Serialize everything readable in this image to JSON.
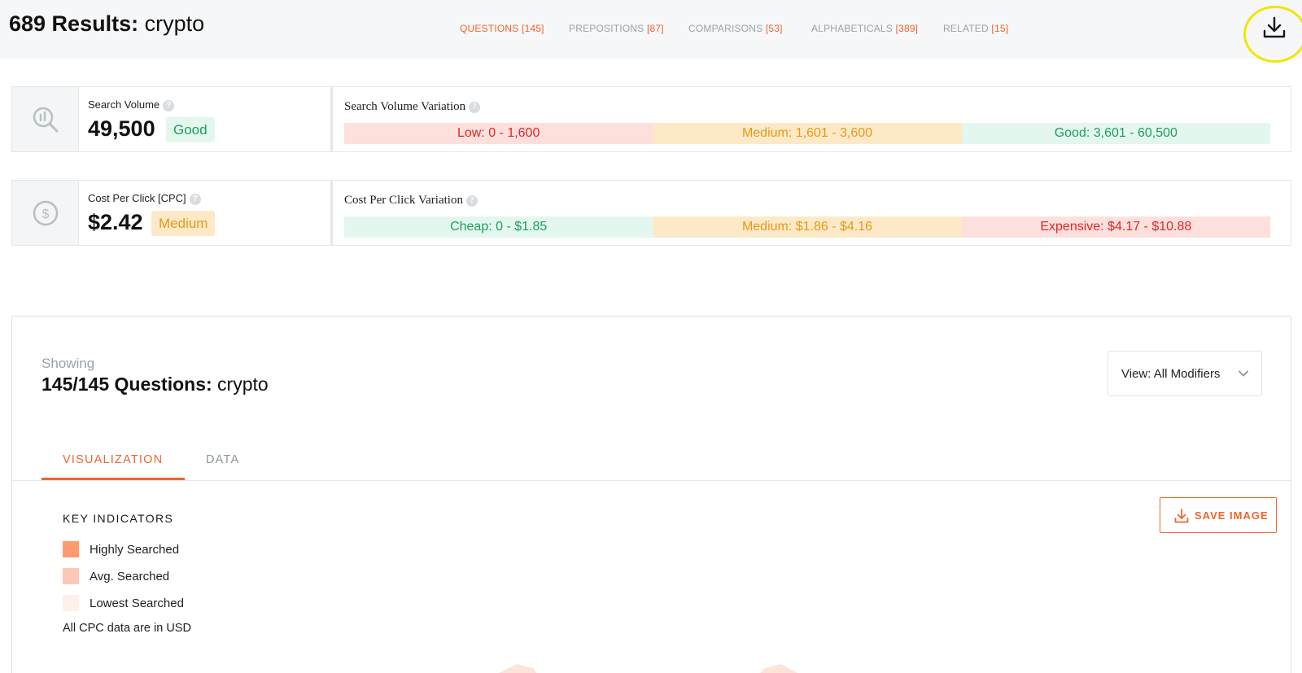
{
  "header": {
    "results_count": "689 Results:",
    "search_term": "crypto",
    "tabs": [
      {
        "label": "QUESTIONS",
        "count": "[145]"
      },
      {
        "label": "PREPOSITIONS",
        "count": "[87]"
      },
      {
        "label": "COMPARISONS",
        "count": "[53]"
      },
      {
        "label": "ALPHABETICALS",
        "count": "[389]"
      },
      {
        "label": "RELATED",
        "count": "[15]"
      }
    ],
    "download_icon": "download-icon"
  },
  "search_volume": {
    "label": "Search Volume",
    "help": "?",
    "value": "49,500",
    "badge": "Good",
    "icon": "search-chart-icon",
    "variation_label": "Search Volume Variation",
    "variation": [
      {
        "text": "Low: 0 - 1,600",
        "tone": "red"
      },
      {
        "text": "Medium: 1,601 - 3,600",
        "tone": "orange"
      },
      {
        "text": "Good: 3,601 - 60,500",
        "tone": "green"
      }
    ]
  },
  "cpc": {
    "label": "Cost Per Click [CPC]",
    "help": "?",
    "value": "$2.42",
    "badge": "Medium",
    "icon": "dollar-icon",
    "variation_label": "Cost Per Click Variation",
    "variation": [
      {
        "text": "Cheap: 0 - $1.85",
        "tone": "green"
      },
      {
        "text": "Medium: $1.86 - $4.16",
        "tone": "orange"
      },
      {
        "text": "Expensive: $4.17 - $10.88",
        "tone": "red"
      }
    ]
  },
  "panel": {
    "showing": "Showing",
    "title_bold": "145/145 Questions:",
    "title_term": "crypto",
    "view_select": "View: All Modifiers",
    "tabs": [
      "VISUALIZATION",
      "DATA"
    ],
    "save_image": "SAVE IMAGE",
    "key_indicators_title": "KEY INDICATORS",
    "legend": [
      {
        "label": "Highly Searched",
        "color": "#ff9a6e"
      },
      {
        "label": "Avg. Searched",
        "color": "#fcc8b7"
      },
      {
        "label": "Lowest Searched",
        "color": "#fff0eb"
      }
    ],
    "cpc_note": "All CPC data are in USD"
  },
  "colors": {
    "accent": "#f0652f",
    "good": "#1e9e5a",
    "medium": "#e39b15",
    "bad": "#e0262a",
    "highlight_circle": "#f4e40a"
  }
}
